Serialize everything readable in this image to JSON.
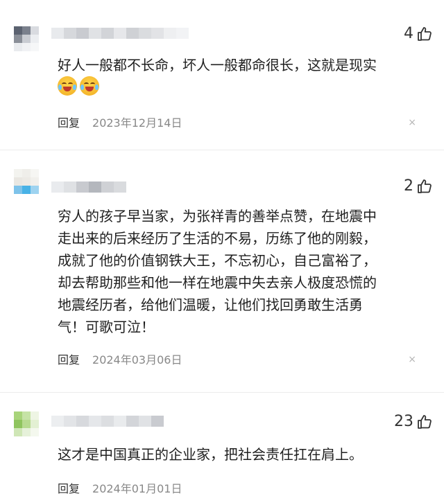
{
  "comments": [
    {
      "like_count": "4",
      "text": "好人一般都不长命，坏人一般都命很长，这就是现实",
      "reply_label": "回复",
      "date": "2023年12月14日",
      "emojis": [
        "crying-laughing-emoji",
        "crying-laughing-emoji"
      ]
    },
    {
      "like_count": "2",
      "text": "穷人的孩子早当家，为张祥青的善举点赞，在地震中\n走出来的后来经历了生活的不易，历练了他的刚毅，\n成就了他的价值钢铁大王，不忘初心，自己富裕了，\n却去帮助那些和他一样在地震中失去亲人极度恐慌的\n地震经历者，给他们温暖，让他们找回勇敢生活勇\n气！可歌可泣！",
      "reply_label": "回复",
      "date": "2024年03月06日"
    },
    {
      "like_count": "23",
      "text": "这才是中国真正的企业家，把社会责任扛在肩上。",
      "reply_label": "回复",
      "date": "2024年01月01日"
    }
  ],
  "close_glyph": "×",
  "icons": {
    "like": "thumbs-up-icon",
    "close": "close-icon"
  },
  "colors": {
    "date": "#888888",
    "text": "#1f1f1f",
    "divider": "#ececec"
  }
}
